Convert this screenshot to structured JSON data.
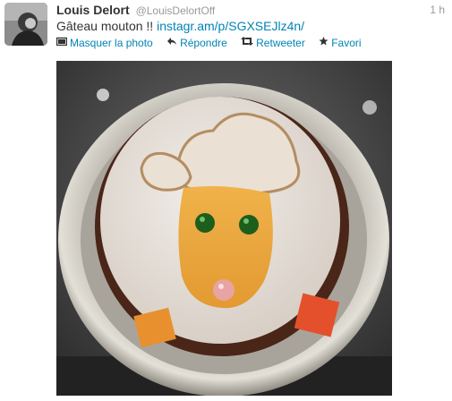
{
  "tweet": {
    "fullname": "Louis Delort",
    "username": "@LouisDelortOff",
    "time": "1 h",
    "text_prefix": "Gâteau mouton !! ",
    "link": "instagr.am/p/SGXSEJlz4n/"
  },
  "actions": {
    "hide_photo": "Masquer la photo",
    "reply": "Répondre",
    "retweet": "Retweeter",
    "favorite": "Favori"
  },
  "icons": {
    "photo": "photo-icon",
    "reply": "reply-arrow-icon",
    "retweet": "retweet-icon",
    "favorite": "star-icon"
  },
  "colors": {
    "link": "#0084b4",
    "name": "#333333",
    "meta": "#999999"
  }
}
